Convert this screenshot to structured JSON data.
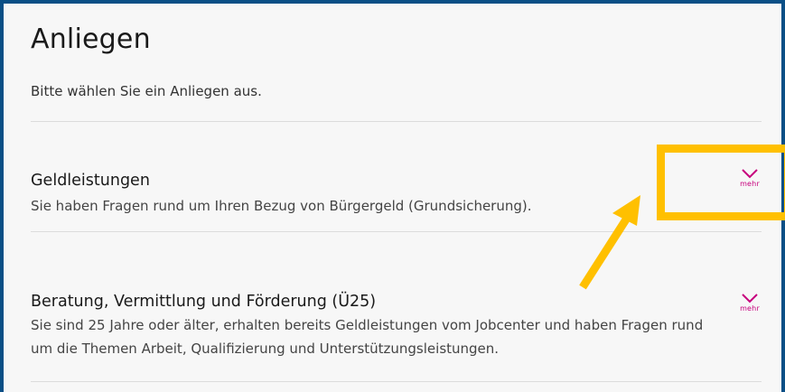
{
  "page": {
    "title": "Anliegen",
    "intro": "Bitte wählen Sie ein Anliegen aus."
  },
  "items": [
    {
      "title": "Geldleistungen",
      "description": "Sie haben Fragen rund um Ihren Bezug von Bürgergeld (Grundsicherung).",
      "more_label": "mehr",
      "more_icon": "chevron-down-icon"
    },
    {
      "title": "Beratung, Vermittlung und Förderung (Ü25)",
      "description": "Sie sind 25 Jahre oder älter, erhalten bereits Geldleistungen vom Jobcenter und haben Fragen rund um die Themen Arbeit, Qualifizierung und Unterstützungsleistungen.",
      "more_label": "mehr",
      "more_icon": "chevron-down-icon"
    }
  ],
  "annotation": {
    "highlight_color": "#ffc000",
    "arrow_color": "#ffc000",
    "arrow_icon": "arrow-up-right-icon"
  },
  "colors": {
    "frame_border": "#0a4f86",
    "accent": "#c7007d",
    "background": "#f7f7f7",
    "divider": "#dcdcdc"
  }
}
